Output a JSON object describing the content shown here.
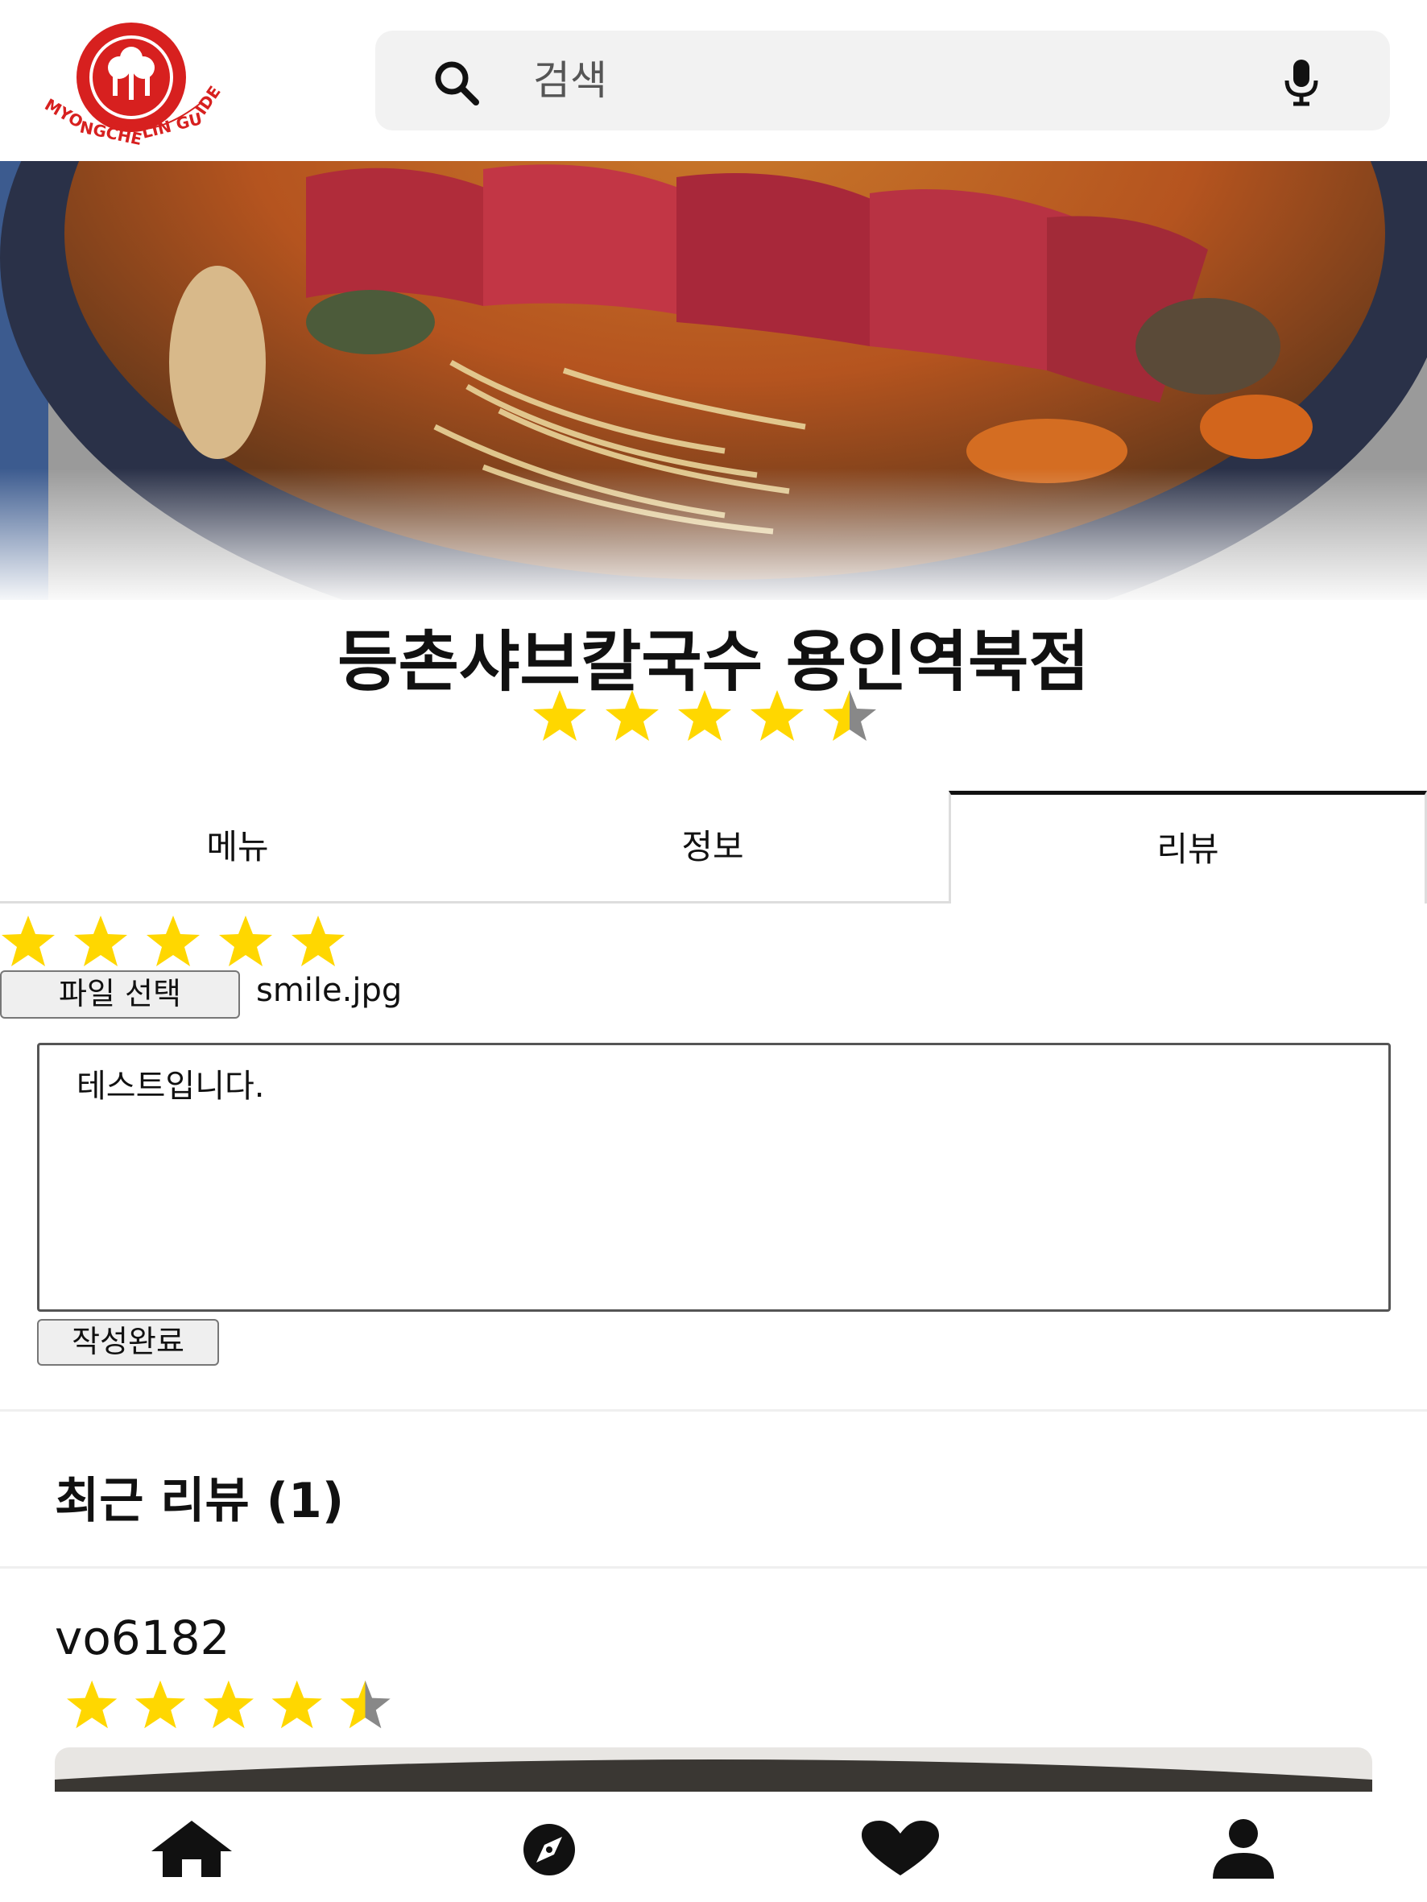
{
  "header": {
    "logo_text": "MYONGCHELIN GUIDE",
    "search_placeholder": "검색"
  },
  "restaurant": {
    "name": "등촌샤브칼국수 용인역북점",
    "rating": 4.5
  },
  "tabs": [
    {
      "label": "메뉴",
      "active": false
    },
    {
      "label": "정보",
      "active": false
    },
    {
      "label": "리뷰",
      "active": true
    }
  ],
  "review_form": {
    "rating": 5,
    "file_button_label": "파일 선택",
    "file_name": "smile.jpg",
    "text": "테스트입니다.",
    "submit_label": "작성완료"
  },
  "recent_reviews": {
    "title": "최근 리뷰 (1)",
    "items": [
      {
        "user": "vo6182",
        "rating": 4.5
      }
    ]
  },
  "colors": {
    "star": "#FFD700",
    "star_empty": "#888888",
    "logo_red": "#D7201F"
  },
  "nav": [
    "home-icon",
    "compass-icon",
    "heart-icon",
    "user-icon"
  ]
}
